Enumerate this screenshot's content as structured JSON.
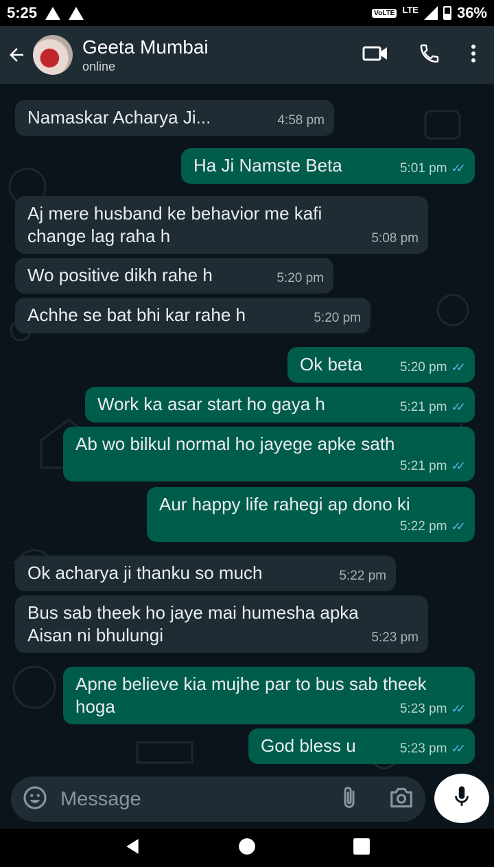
{
  "status_bar": {
    "time": "5:25",
    "volte": "VoLTE",
    "network": "LTE",
    "battery": "36%"
  },
  "header": {
    "contact_name": "Geeta Mumbai",
    "contact_status": "online",
    "icons": [
      "back-arrow-icon",
      "video-call-icon",
      "phone-icon",
      "more-options-icon"
    ]
  },
  "messages": [
    {
      "dir": "in",
      "text": "Namaskar Acharya Ji...",
      "time": "4:58 pm"
    },
    {
      "dir": "out",
      "text": "Ha Ji Namste Beta",
      "time": "5:01 pm",
      "read": true
    },
    {
      "dir": "in",
      "text": "Aj mere husband ke behavior me kafi change lag raha h",
      "time": "5:08 pm"
    },
    {
      "dir": "in",
      "text": "Wo positive dikh rahe h",
      "time": "5:20 pm"
    },
    {
      "dir": "in",
      "text": "Achhe se bat bhi kar rahe h",
      "time": "5:20 pm"
    },
    {
      "dir": "out",
      "text": "Ok beta",
      "time": "5:20 pm",
      "read": true
    },
    {
      "dir": "out",
      "text": "Work ka asar start ho gaya h",
      "time": "5:21 pm",
      "read": true
    },
    {
      "dir": "out",
      "text": "Ab wo bilkul normal ho jayege apke sath",
      "time": "5:21 pm",
      "read": true
    },
    {
      "dir": "out",
      "text": "Aur happy life rahegi ap dono ki",
      "time": "5:22 pm",
      "read": true
    },
    {
      "dir": "in",
      "text": "Ok acharya ji thanku so much",
      "time": "5:22 pm"
    },
    {
      "dir": "in",
      "text": "Bus sab theek ho jaye mai humesha apka Aisan ni bhulungi",
      "time": "5:23 pm"
    },
    {
      "dir": "out",
      "text": "Apne believe kia mujhe par to bus sab theek hoga",
      "time": "5:23 pm",
      "read": true
    },
    {
      "dir": "out",
      "text": "God bless u",
      "time": "5:23 pm",
      "read": true
    }
  ],
  "composer": {
    "placeholder": "Message",
    "icons": [
      "emoji-icon",
      "attach-icon",
      "camera-icon",
      "mic-icon"
    ]
  },
  "colors": {
    "chat_bg": "#0b141a",
    "incoming_bubble": "#1f2c34",
    "outgoing_bubble": "#005c4b",
    "read_ticks": "#53bdeb"
  }
}
